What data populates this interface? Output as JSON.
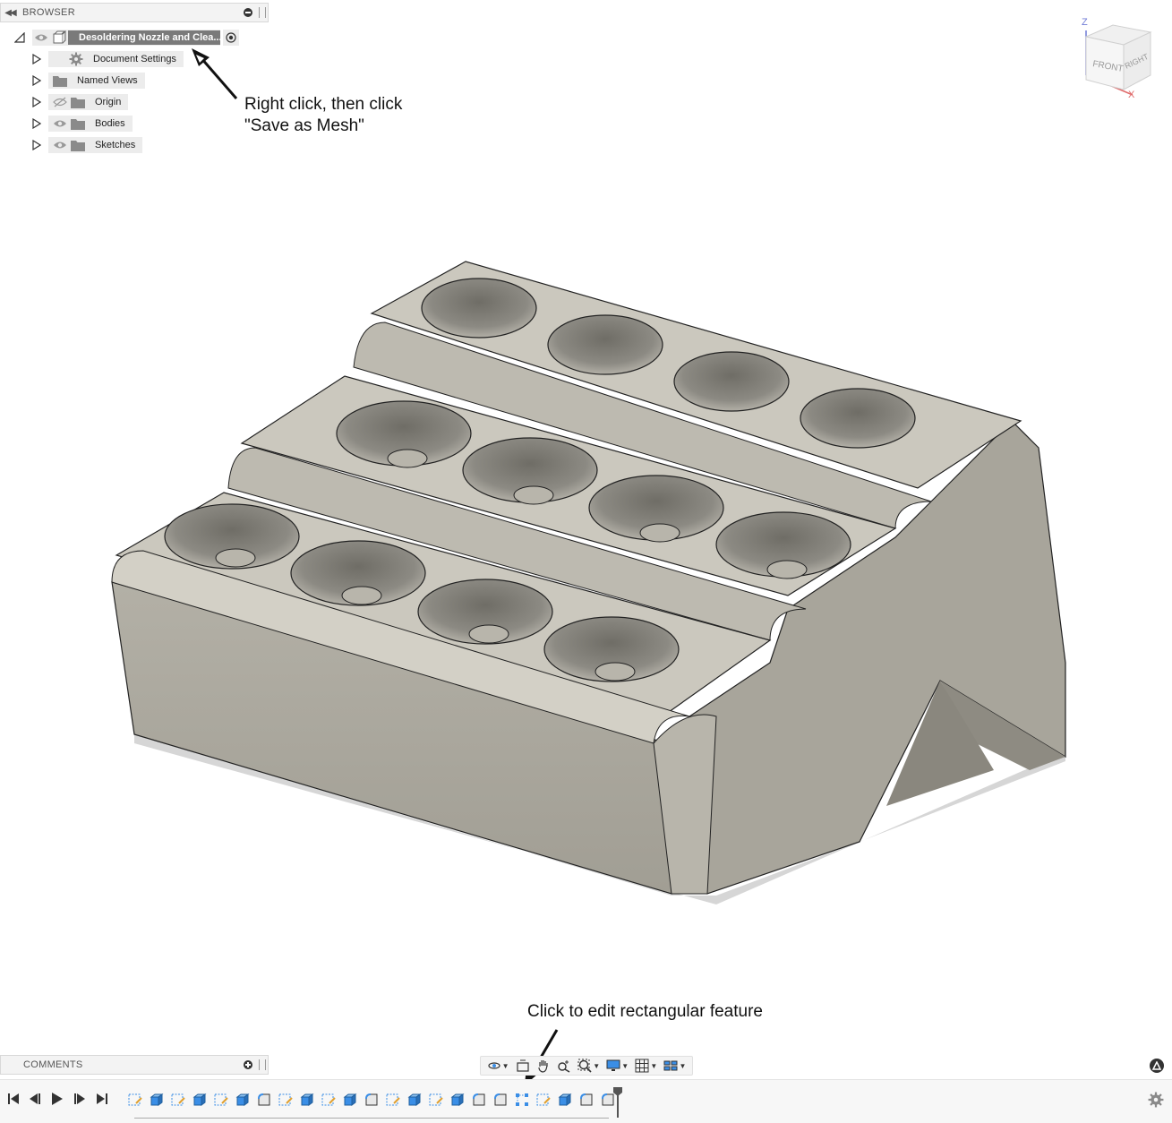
{
  "browser": {
    "title": "BROWSER",
    "root": {
      "label": "Desoldering Nozzle and Clea..."
    },
    "items": [
      {
        "label": "Document Settings",
        "icon": "gear-icon",
        "visible": null
      },
      {
        "label": "Named Views",
        "icon": "folder-icon",
        "visible": null
      },
      {
        "label": "Origin",
        "icon": "folder-icon",
        "visible": false
      },
      {
        "label": "Bodies",
        "icon": "folder-icon",
        "visible": true
      },
      {
        "label": "Sketches",
        "icon": "folder-icon",
        "visible": true
      }
    ]
  },
  "annotations": {
    "top_line1": "Right click, then click",
    "top_line2": "\"Save as Mesh\"",
    "bottom": "Click to edit rectangular feature"
  },
  "comments": {
    "title": "COMMENTS"
  },
  "viewcube": {
    "front": "FRONT",
    "right": "RIGHT",
    "z": "Z",
    "x": "X"
  },
  "colors": {
    "model_top": "#c9c6bc",
    "model_side": "#a9a69c",
    "accent_blue": "#3a8ee6",
    "axis_z": "#6f7bd6",
    "axis_x": "#e06b6b"
  },
  "timeline": {
    "features": [
      "sketch",
      "extrude",
      "sketch",
      "extrude",
      "sketch",
      "extrude",
      "fillet",
      "sketch",
      "extrude",
      "sketch",
      "extrude",
      "fillet",
      "sketch",
      "extrude",
      "sketch",
      "extrude",
      "fillet",
      "fillet",
      "rect-pattern",
      "sketch",
      "extrude",
      "fillet",
      "fillet"
    ]
  }
}
